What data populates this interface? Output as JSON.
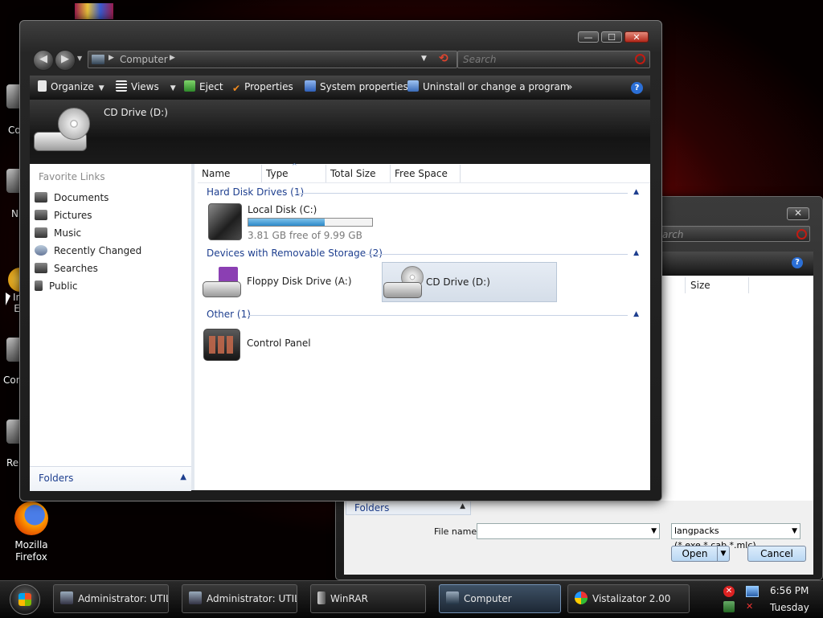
{
  "desktop": {
    "icons": [
      {
        "label": "Co",
        "color": "#8c8c8c"
      },
      {
        "label": "N",
        "color": "#8c8c8c"
      },
      {
        "label": "In\nE",
        "color": "#3a6fd1"
      },
      {
        "label": "Cor",
        "color": "#8c8c8c"
      },
      {
        "label": "Re",
        "color": "#8c8c8c"
      },
      {
        "label": "Mozilla Firefox",
        "color": "#e66000"
      }
    ]
  },
  "bg_dialog": {
    "close_label": "✕",
    "search_placeholder": "arch",
    "col_size": "Size",
    "folders_label": "Folders",
    "file_name_label": "File name:",
    "file_name_value": "",
    "file_type_value": "langpacks (*.exe,*.cab,*.mlc)",
    "open_label": "Open",
    "cancel_label": "Cancel"
  },
  "window": {
    "title_buttons": {
      "minimize": "—",
      "maximize": "☐",
      "close": "✕"
    },
    "address": "Computer",
    "search_placeholder": "Search",
    "toolbar": {
      "organize": "Organize",
      "views": "Views",
      "eject": "Eject",
      "properties": "Properties",
      "system_properties": "System properties",
      "uninstall": "Uninstall or change a program",
      "more": "»",
      "help": "?"
    },
    "header_pane": {
      "title": "CD Drive (D:)"
    },
    "favorite_links": {
      "title": "Favorite Links",
      "items": [
        "Documents",
        "Pictures",
        "Music",
        "Recently Changed",
        "Searches",
        "Public"
      ]
    },
    "folders_label": "Folders",
    "columns": [
      "Name",
      "Type",
      "Total Size",
      "Free Space"
    ],
    "groups": [
      {
        "title": "Hard Disk Drives (1)"
      },
      {
        "title": "Devices with Removable Storage (2)"
      },
      {
        "title": "Other (1)"
      }
    ],
    "items": {
      "local_disk": {
        "name": "Local Disk (C:)",
        "free_text": "3.81 GB free of 9.99 GB",
        "used_fraction": 0.62
      },
      "floppy": {
        "name": "Floppy Disk Drive (A:)"
      },
      "cd": {
        "name": "CD Drive (D:)"
      },
      "control_panel": {
        "name": "Control Panel"
      }
    }
  },
  "taskbar": {
    "tasks": [
      {
        "label": "Administrator: UTIL..."
      },
      {
        "label": "Administrator: UTIL..."
      },
      {
        "label": "WinRAR"
      },
      {
        "label": "Computer"
      },
      {
        "label": "Vistalizator 2.00"
      }
    ],
    "clock_time": "6:56 PM",
    "clock_day": "Tuesday"
  }
}
